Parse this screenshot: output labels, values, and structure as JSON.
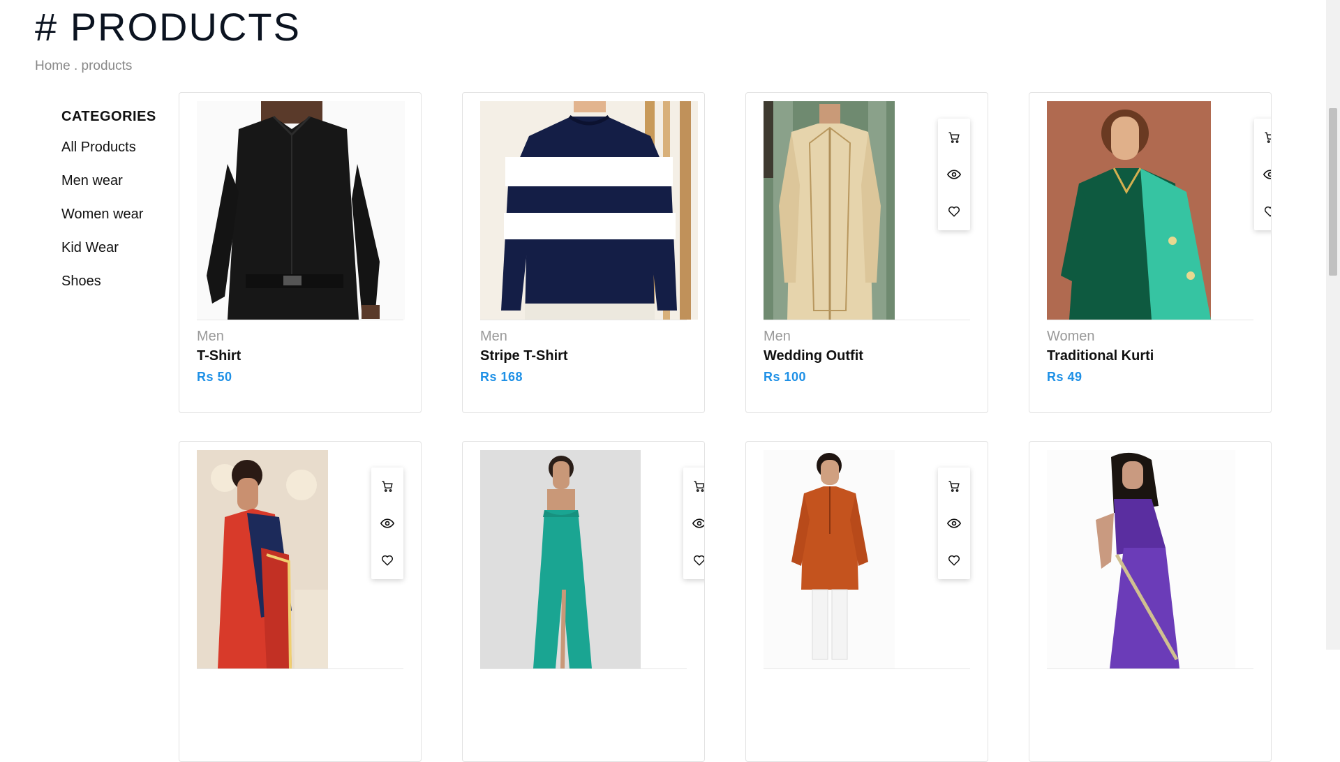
{
  "page": {
    "title": "# PRODUCTS",
    "breadcrumb_home": "Home",
    "breadcrumb_sep": ".",
    "breadcrumb_current": "products"
  },
  "sidebar": {
    "heading": "CATEGORIES",
    "items": [
      "All Products",
      "Men wear",
      "Women wear",
      "Kid Wear",
      "Shoes"
    ]
  },
  "icons": {
    "cart": "cart-icon",
    "view": "eye-icon",
    "wishlist": "heart-icon"
  },
  "colors": {
    "price": "#1e90e6",
    "title": "#0b1320"
  },
  "products": [
    {
      "category": "Men",
      "name": "T-Shirt",
      "price": "Rs 50"
    },
    {
      "category": "Men",
      "name": "Stripe T-Shirt",
      "price": "Rs 168"
    },
    {
      "category": "Men",
      "name": "Wedding Outfit",
      "price": "Rs 100"
    },
    {
      "category": "Women",
      "name": "Traditional Kurti",
      "price": "Rs 49"
    },
    {
      "category": "",
      "name": "",
      "price": ""
    },
    {
      "category": "",
      "name": "",
      "price": ""
    },
    {
      "category": "",
      "name": "",
      "price": ""
    },
    {
      "category": "",
      "name": "",
      "price": ""
    }
  ]
}
